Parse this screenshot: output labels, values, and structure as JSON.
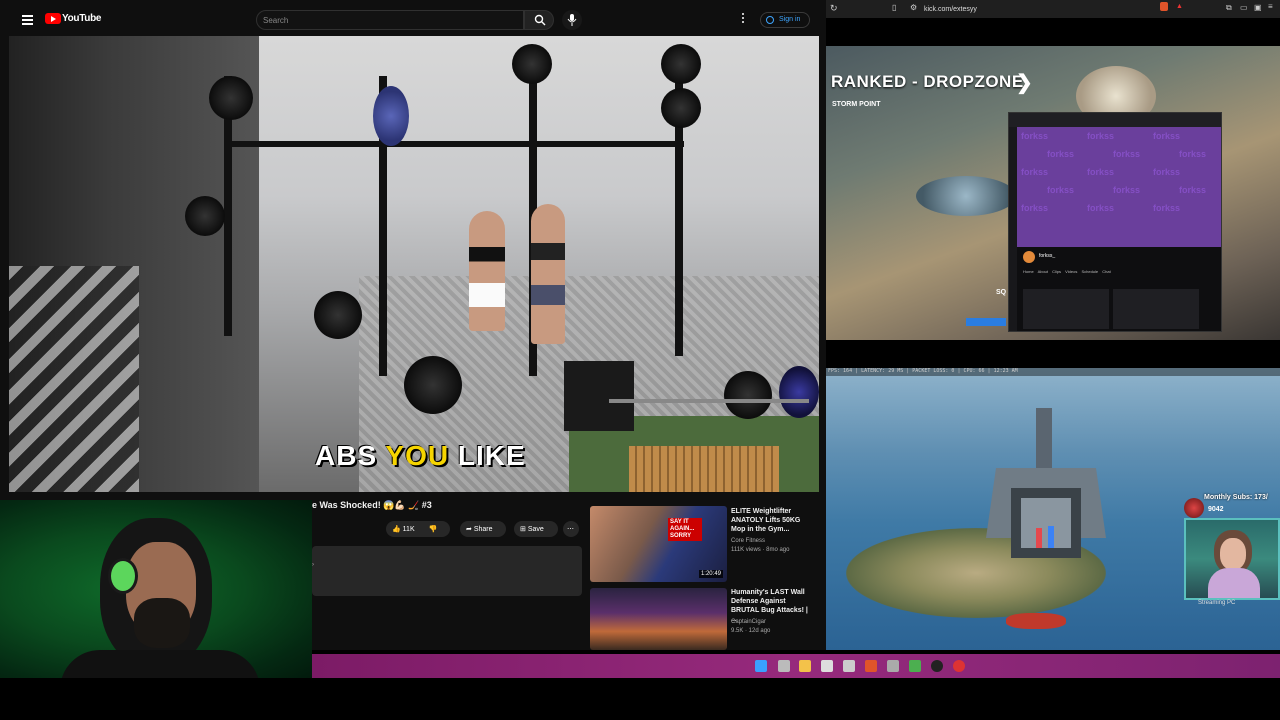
{
  "youtube": {
    "logo_text": "YouTube",
    "search_placeholder": "Search",
    "signin_label": "Sign in",
    "caption": {
      "part1": "ABS ",
      "highlight": "YOU",
      "part2": " LIKE"
    },
    "video_title": "e Was Shocked! 😱💪🏻 🏒 #3",
    "actions": {
      "like_count": "11K",
      "share_label": "Share",
      "save_label": "Save"
    },
    "recommendations": [
      {
        "title": "ELITE Weightlifter ANATOLY Lifts 50KG Mop in the Gym... ",
        "channel": "Core Fitness",
        "meta": "111K views · 8mo ago",
        "thumb_text": "SAY IT AGAIN... SORRY",
        "duration": "1:20:49"
      },
      {
        "title": "Humanity's LAST Wall Defense Against BRUTAL Bug Attacks! | ...",
        "channel": "CaptainCigar",
        "meta": "9.5K · 12d ago",
        "thumb_text": "",
        "duration": ""
      }
    ]
  },
  "browser": {
    "url": "kick.com/extesyy"
  },
  "stream1": {
    "mode_title": "RANKED - DROPZONE",
    "subtitle": "STORM POINT",
    "overlay_word": "forkss",
    "inner_channel": "forkss_",
    "inner_tabs": [
      "Home",
      "About",
      "Clips",
      "Videos",
      "Schedule",
      "Chat"
    ],
    "score_label": "SQ"
  },
  "stream2": {
    "hud_text": "FPS: 164 | LATENCY: 29 MS | PACKET LOSS: 0 | CPU: 66 | 12:23 AM",
    "monthly_subs": "Monthly Subs: 173/",
    "sub_count": "9042",
    "cam_label": "Streaming PC"
  },
  "colors": {
    "youtube_red": "#ff0000",
    "link_blue": "#3ea6ff",
    "caption_yellow": "#f6d400",
    "taskbar": "#8a2373",
    "twitch_purple": "#9b5de5"
  }
}
